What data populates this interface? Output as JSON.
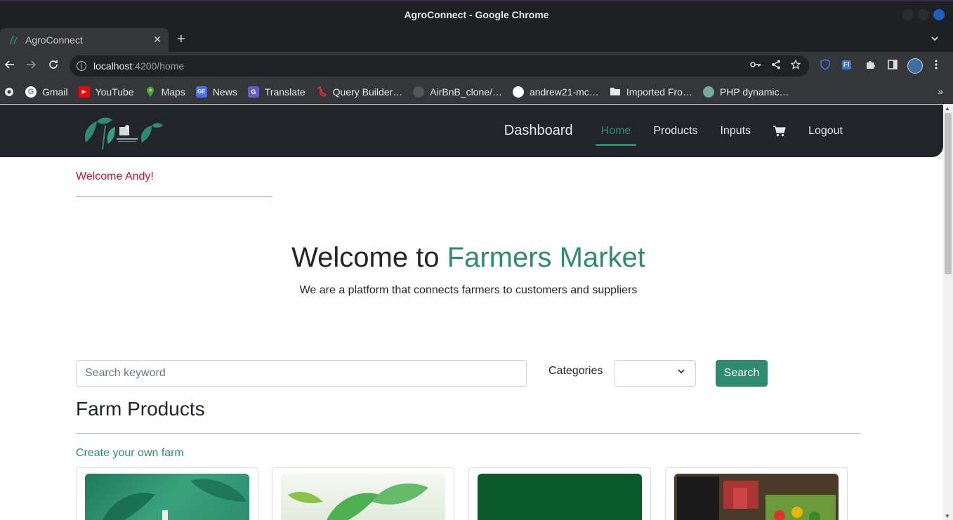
{
  "window": {
    "title": "AgroConnect - Google Chrome"
  },
  "tab": {
    "title": "AgroConnect",
    "close": "✕",
    "new": "+"
  },
  "address": {
    "host": "localhost",
    "path": ":4200/home"
  },
  "bookmarks": [
    {
      "label": "Gmail",
      "icon": "google-icon",
      "color": "#ffffff"
    },
    {
      "label": "YouTube",
      "icon": "youtube-icon",
      "color": "#ff0000"
    },
    {
      "label": "Maps",
      "icon": "maps-icon",
      "color": "#34a853"
    },
    {
      "label": "News",
      "icon": "news-icon",
      "color": "#4a6cf7"
    },
    {
      "label": "Translate",
      "icon": "translate-icon",
      "color": "#6a5acd"
    },
    {
      "label": "Query Builder…",
      "icon": "laravel-icon",
      "color": "#e3342f"
    },
    {
      "label": "AirBnB_clone/…",
      "icon": "github-icon",
      "color": "#555555"
    },
    {
      "label": "andrew21-mc…",
      "icon": "github-icon",
      "color": "#ffffff"
    },
    {
      "label": "Imported Fro…",
      "icon": "folder-icon",
      "color": "#e8e8e8"
    },
    {
      "label": "PHP dynamic…",
      "icon": "chatgpt-icon",
      "color": "#74aa9c"
    }
  ],
  "nav": {
    "dashboard": "Dashboard",
    "home": "Home",
    "products": "Products",
    "inputs": "Inputs",
    "logout": "Logout"
  },
  "welcome_user": "Welcome Andy!",
  "hero": {
    "title_prefix": "Welcome to ",
    "title_accent": "Farmers Market",
    "subtitle": "We are a platform that connects farmers to customers and suppliers"
  },
  "search": {
    "placeholder": "Search keyword",
    "categories_label": "Categories",
    "category_value": "",
    "button": "Search"
  },
  "products": {
    "title": "Farm Products",
    "create_link": "Create your own farm"
  },
  "colors": {
    "accent": "#2e8b6e",
    "welcome": "#d0103a",
    "navbar": "#212529"
  }
}
